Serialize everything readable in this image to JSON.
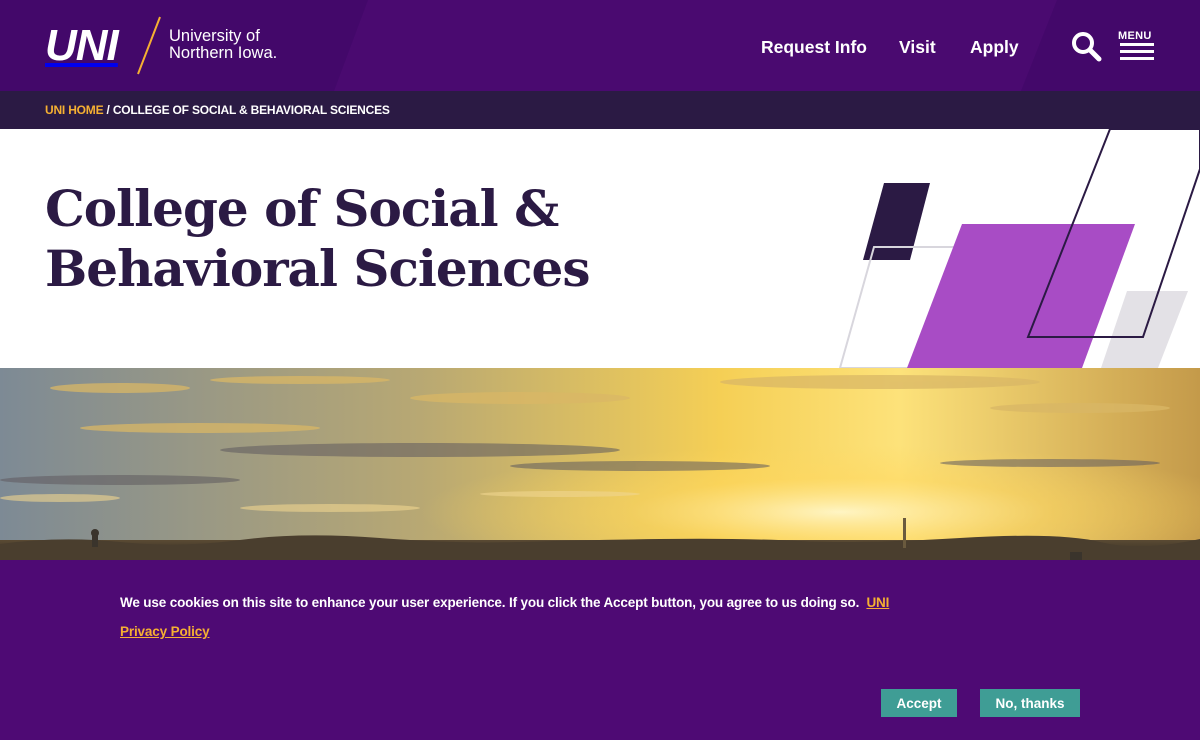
{
  "header": {
    "logo_mark": "UNI",
    "logo_line1": "University of",
    "logo_line2": "Northern Iowa.",
    "nav": [
      "Request Info",
      "Visit",
      "Apply"
    ],
    "menu_label": "MENU",
    "colors": {
      "primary": "#4a0a70",
      "accent": "#f6b032"
    }
  },
  "breadcrumb": {
    "home": "UNI HOME",
    "separator": " / ",
    "current": "COLLEGE OF SOCIAL & BEHAVIORAL SCIENCES"
  },
  "page": {
    "title_line1": "College of Social &",
    "title_line2": "Behavioral Sciences"
  },
  "hero": {
    "description_icon": "sunset-campus-image"
  },
  "cookie": {
    "message": "We use cookies on this site to enhance your user experience. If you click the Accept button, you agree to us doing so.",
    "link_text_1": "UNI",
    "link_text_2": "Privacy Policy",
    "accept": "Accept",
    "decline": "No, thanks",
    "button_color": "#3f9d95"
  }
}
